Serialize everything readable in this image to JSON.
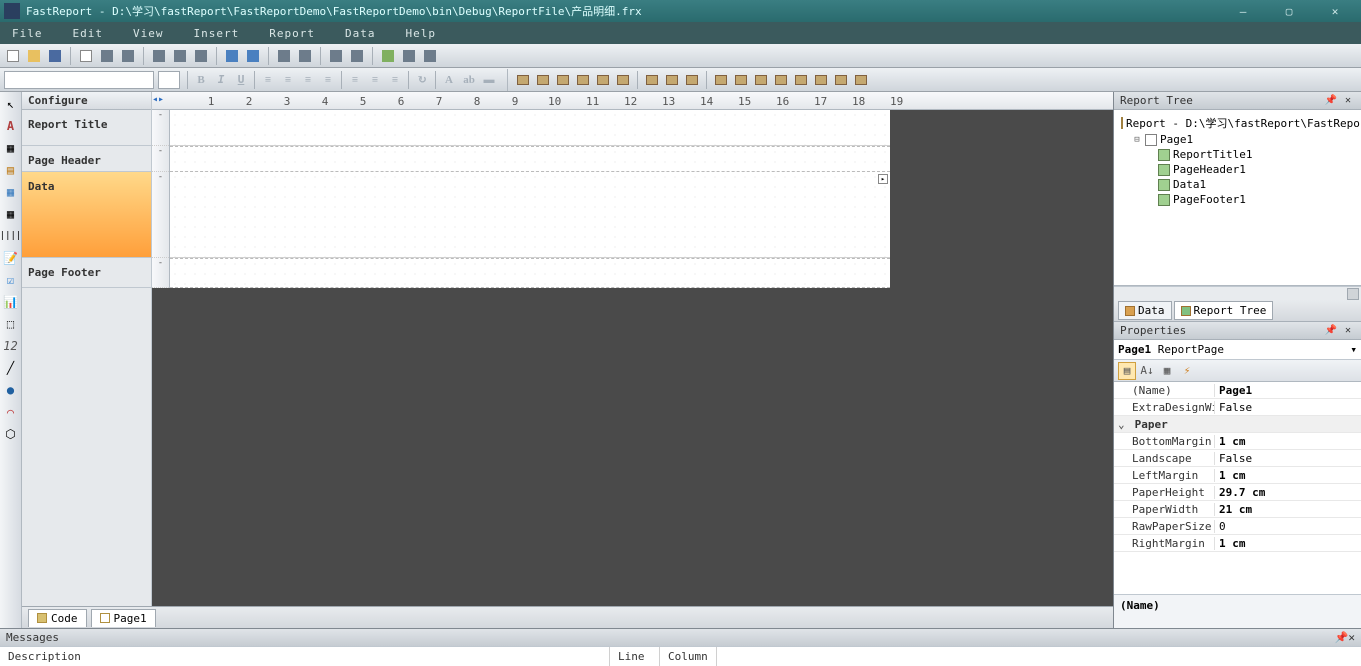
{
  "title": "FastReport - D:\\学习\\fastReport\\FastReportDemo\\FastReportDemo\\bin\\Debug\\ReportFile\\产品明细.frx",
  "menu": [
    "File",
    "Edit",
    "View",
    "Insert",
    "Report",
    "Data",
    "Help"
  ],
  "bands": {
    "configure": "Configure",
    "items": [
      {
        "label": "Report Title",
        "cls": "h1"
      },
      {
        "label": "Page Header",
        "cls": "h2"
      },
      {
        "label": "Data",
        "cls": "h3",
        "sel": true
      },
      {
        "label": "Page Footer",
        "cls": "h4"
      }
    ]
  },
  "rulerTicks": [
    1,
    2,
    3,
    4,
    5,
    6,
    7,
    8,
    9,
    10,
    11,
    12,
    13,
    14,
    15,
    16,
    17,
    18,
    19
  ],
  "vTicks": [
    "-",
    "-",
    "-",
    "-",
    "-"
  ],
  "bottomTabs": [
    {
      "label": "Code"
    },
    {
      "label": "Page1"
    }
  ],
  "reportTree": {
    "title": "Report Tree",
    "root": "Report - D:\\学习\\fastReport\\FastRepor",
    "page": "Page1",
    "children": [
      "ReportTitle1",
      "PageHeader1",
      "Data1",
      "PageFooter1"
    ],
    "tabs": [
      {
        "label": "Data"
      },
      {
        "label": "Report Tree",
        "act": true
      }
    ]
  },
  "properties": {
    "title": "Properties",
    "object": "Page1",
    "objectType": "ReportPage",
    "rows": [
      {
        "k": "(Name)",
        "v": "Page1",
        "bold": true
      },
      {
        "k": "ExtraDesignWi",
        "v": "False"
      },
      {
        "cat": true,
        "k": "Paper"
      },
      {
        "k": "BottomMargin",
        "v": "1 cm",
        "bold": true
      },
      {
        "k": "Landscape",
        "v": "False"
      },
      {
        "k": "LeftMargin",
        "v": "1 cm",
        "bold": true
      },
      {
        "k": "PaperHeight",
        "v": "29.7 cm",
        "bold": true
      },
      {
        "k": "PaperWidth",
        "v": "21 cm",
        "bold": true
      },
      {
        "k": "RawPaperSize",
        "v": "0"
      },
      {
        "k": "RightMargin",
        "v": "1 cm",
        "bold": true
      }
    ],
    "help": "(Name)"
  },
  "messages": {
    "title": "Messages"
  },
  "status": {
    "desc": "Description",
    "line": "Line",
    "col": "Column"
  }
}
